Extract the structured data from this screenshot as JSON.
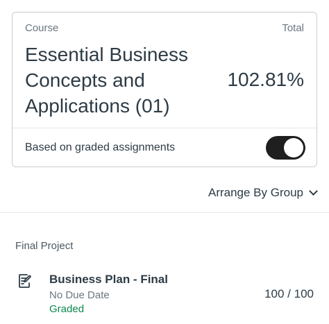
{
  "course_card": {
    "course_label": "Course",
    "total_label": "Total",
    "course_name": "Essential Business Concepts and Applications (01)",
    "total_value": "102.81%",
    "graded_toggle_label": "Based on graded assignments",
    "graded_toggle_on": true
  },
  "arrange": {
    "label": "Arrange By Group",
    "icon": "chevron-down-icon"
  },
  "groups": [
    {
      "title": "Final Project",
      "assignments": [
        {
          "icon": "assignment-icon",
          "title": "Business Plan - Final",
          "due": "No Due Date",
          "status": "Graded",
          "score": "100 / 100"
        }
      ]
    }
  ],
  "colors": {
    "text": "#2d3b45",
    "muted": "#6b7780",
    "graded": "#0b874b",
    "toggle_on": "#1f1f1f"
  }
}
